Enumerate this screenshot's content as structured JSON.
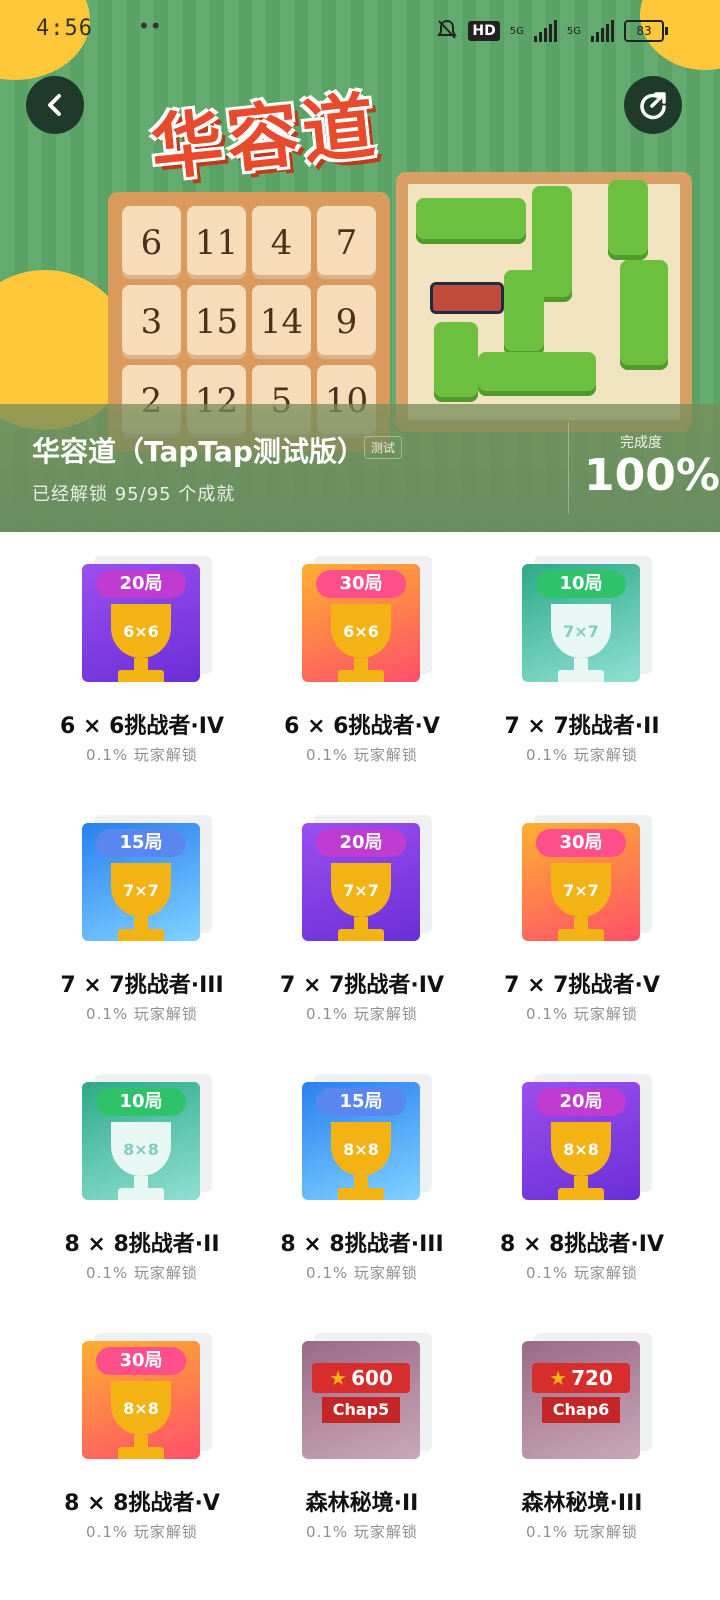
{
  "status_bar": {
    "time": "4:56",
    "dots": "••",
    "network_1": "5G",
    "network_2": "5G",
    "hd_label": "HD",
    "battery": "83"
  },
  "header": {
    "logo_text": "华容道",
    "board_tiles": [
      "6",
      "11",
      "4",
      "7",
      "3",
      "15",
      "14",
      "9",
      "2",
      "12",
      "5",
      "10"
    ],
    "back_icon": "chevron-left-icon",
    "share_icon": "share-icon"
  },
  "info": {
    "game_title": "华容道（TapTap测试版）",
    "test_badge": "测试",
    "unlock_text": "已经解锁 95/95 个成就",
    "completion_label": "完成度",
    "completion_value": "100%"
  },
  "achievements": [
    {
      "banner": "20局",
      "cup_label": "6×6",
      "title": "6 × 6挑战者·IV",
      "subtitle": "0.1% 玩家解锁",
      "theme": "purple"
    },
    {
      "banner": "30局",
      "cup_label": "6×6",
      "title": "6 × 6挑战者·V",
      "subtitle": "0.1% 玩家解锁",
      "theme": "orange"
    },
    {
      "banner": "10局",
      "cup_label": "7×7",
      "title": "7 × 7挑战者·II",
      "subtitle": "0.1% 玩家解锁",
      "theme": "teal"
    },
    {
      "banner": "15局",
      "cup_label": "7×7",
      "title": "7 × 7挑战者·III",
      "subtitle": "0.1% 玩家解锁",
      "theme": "blue"
    },
    {
      "banner": "20局",
      "cup_label": "7×7",
      "title": "7 × 7挑战者·IV",
      "subtitle": "0.1% 玩家解锁",
      "theme": "purple"
    },
    {
      "banner": "30局",
      "cup_label": "7×7",
      "title": "7 × 7挑战者·V",
      "subtitle": "0.1% 玩家解锁",
      "theme": "orange"
    },
    {
      "banner": "10局",
      "cup_label": "8×8",
      "title": "8 × 8挑战者·II",
      "subtitle": "0.1% 玩家解锁",
      "theme": "teal"
    },
    {
      "banner": "15局",
      "cup_label": "8×8",
      "title": "8 × 8挑战者·III",
      "subtitle": "0.1% 玩家解锁",
      "theme": "blue"
    },
    {
      "banner": "20局",
      "cup_label": "8×8",
      "title": "8 × 8挑战者·IV",
      "subtitle": "0.1% 玩家解锁",
      "theme": "purple"
    },
    {
      "banner": "30局",
      "cup_label": "8×8",
      "title": "8 × 8挑战者·V",
      "subtitle": "0.1% 玩家解锁",
      "theme": "orange"
    },
    {
      "banner": "600",
      "cup_label": "Chap5",
      "title": "森林秘境·II",
      "subtitle": "0.1% 玩家解锁",
      "theme": "forest"
    },
    {
      "banner": "720",
      "cup_label": "Chap6",
      "title": "森林秘境·III",
      "subtitle": "0.1% 玩家解锁",
      "theme": "forest"
    }
  ],
  "theme_colors": {
    "purple": "#7d3ee0",
    "orange": "#ff7a3d",
    "teal": "#3fbfa8",
    "blue": "#2f8bf0",
    "forest": "#8a5a78",
    "gold": "#f4b315",
    "white_cup": "#e9f7f4",
    "header_green": "#5aa265",
    "accent_red": "#e84a2c"
  }
}
